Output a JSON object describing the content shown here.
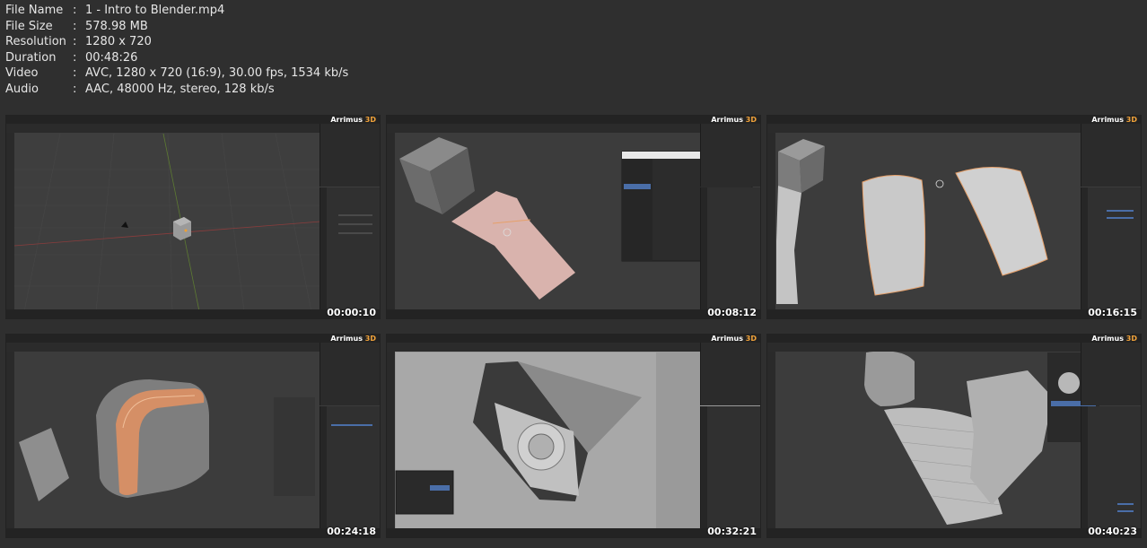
{
  "file_info": {
    "rows": [
      {
        "label": "File Name",
        "value": "1 - Intro to Blender.mp4"
      },
      {
        "label": "File Size",
        "value": "578.98 MB"
      },
      {
        "label": "Resolution",
        "value": "1280 x 720"
      },
      {
        "label": "Duration",
        "value": "00:48:26"
      },
      {
        "label": "Video",
        "value": "AVC, 1280 x 720 (16:9), 30.00 fps, 1534 kb/s"
      },
      {
        "label": "Audio",
        "value": "AAC, 48000 Hz, stereo, 128 kb/s"
      }
    ],
    "separator": ":"
  },
  "brand": {
    "prefix": "Arrimus",
    "suffix": "3D"
  },
  "thumbnails": [
    {
      "timestamp": "00:00:10"
    },
    {
      "timestamp": "00:08:12"
    },
    {
      "timestamp": "00:16:15"
    },
    {
      "timestamp": "00:24:18"
    },
    {
      "timestamp": "00:32:21"
    },
    {
      "timestamp": "00:40:23"
    }
  ]
}
